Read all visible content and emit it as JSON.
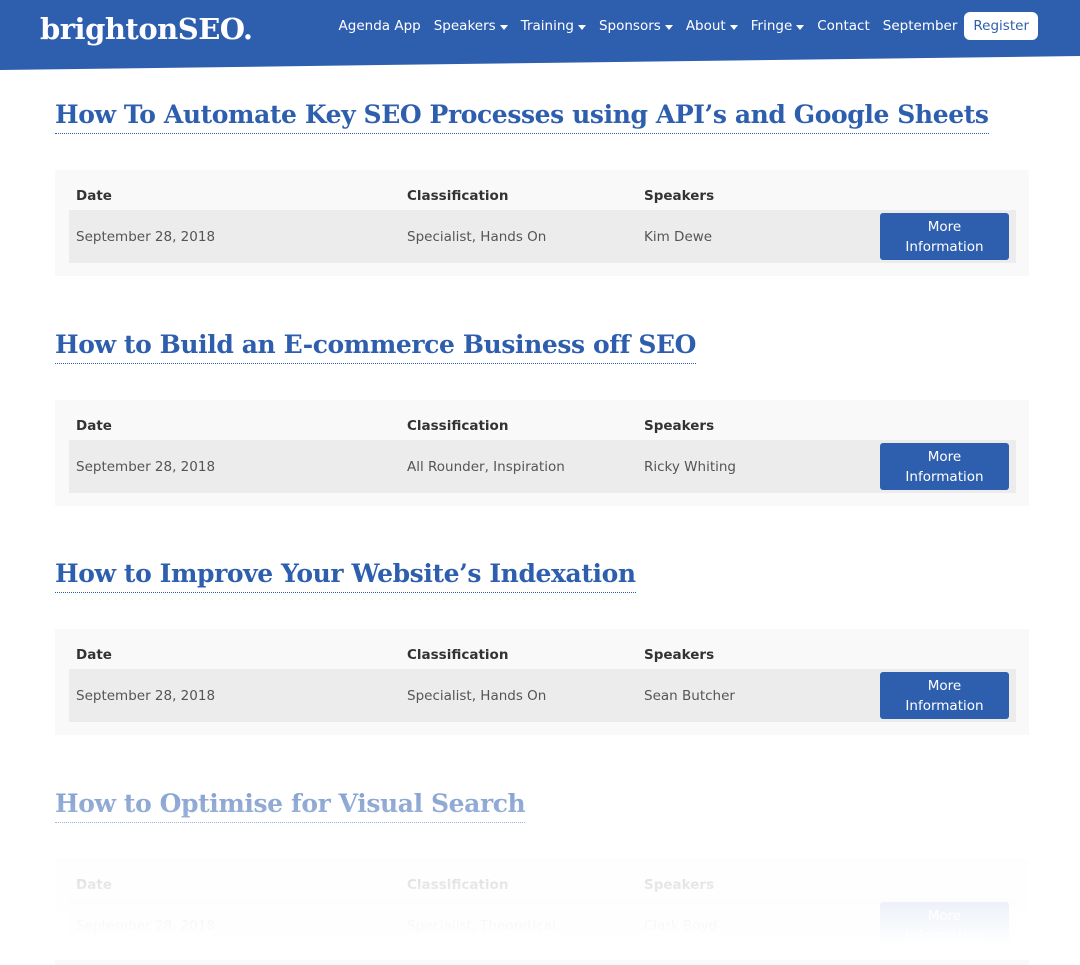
{
  "header": {
    "logo": "brightonSEO.",
    "nav": [
      {
        "label": "Agenda App",
        "dropdown": false
      },
      {
        "label": "Speakers",
        "dropdown": true
      },
      {
        "label": "Training",
        "dropdown": true
      },
      {
        "label": "Sponsors",
        "dropdown": true
      },
      {
        "label": "About",
        "dropdown": true
      },
      {
        "label": "Fringe",
        "dropdown": true
      },
      {
        "label": "Contact",
        "dropdown": false
      },
      {
        "label": "September",
        "dropdown": false
      }
    ],
    "register_label": "Register",
    "brand_color": "#2e5fae"
  },
  "table_headers": {
    "date": "Date",
    "classification": "Classification",
    "speakers": "Speakers"
  },
  "more_info_label": "More Information",
  "sessions": [
    {
      "title": "How To Automate Key SEO Processes using API’s and Google Sheets",
      "date": "September 28, 2018",
      "classification": "Specialist, Hands On",
      "speakers": "Kim Dewe"
    },
    {
      "title": "How to Build an E-commerce Business off SEO",
      "date": "September 28, 2018",
      "classification": "All Rounder, Inspiration",
      "speakers": "Ricky Whiting"
    },
    {
      "title": "How to Improve Your Website’s Indexation",
      "date": "September 28, 2018",
      "classification": "Specialist, Hands On",
      "speakers": "Sean Butcher"
    },
    {
      "title": "How to Optimise for Visual Search",
      "date": "September 28, 2018",
      "classification": "Specialist, Theoretical",
      "speakers": "Clark Boyd"
    }
  ]
}
